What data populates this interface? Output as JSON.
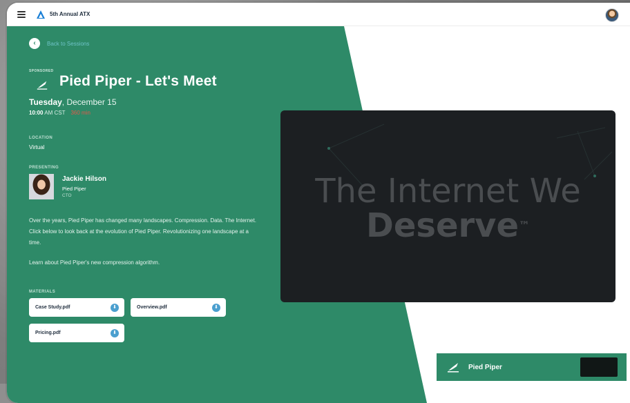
{
  "app": {
    "name": "5th Annual ATX"
  },
  "nav": {
    "back_label": "Back to Sessions"
  },
  "session": {
    "sponsored_tag": "SPONSORED",
    "title": "Pied Piper - Let's Meet",
    "day": "Tuesday",
    "date_rest": ", December 15",
    "time": "10:00",
    "ampm": "AM CST",
    "duration": "360 min",
    "location_label": "LOCATION",
    "location": "Virtual",
    "presenting_label": "PRESENTING",
    "presenter": {
      "name": "Jackie Hilson",
      "company": "Pied Piper",
      "role": "CTO"
    },
    "description": "Over the years, Pied Piper has changed many landscapes. Compression. Data. The Internet. Click below to look back at the evolution of Pied Piper. Revolutionizing one landscape at a time.",
    "learn_more": "Learn about Pied Piper's new compression algorithm.",
    "materials_label": "MATERIALS",
    "materials": [
      {
        "name": "Case Study.pdf"
      },
      {
        "name": "Overview.pdf"
      },
      {
        "name": "Pricing.pdf"
      }
    ]
  },
  "video": {
    "line1": "The Internet We",
    "line2": "Deserve",
    "trademark": "™"
  },
  "sponsor": {
    "name": "Pied Piper"
  },
  "icons": {
    "menu": "hamburger-icon",
    "brand": "triangle-logo-icon",
    "back": "chevron-left-icon",
    "download": "download-icon"
  },
  "colors": {
    "green": "#2e8a68",
    "accent_blue": "#4b9fcf",
    "duration_red": "#e15a4b"
  }
}
